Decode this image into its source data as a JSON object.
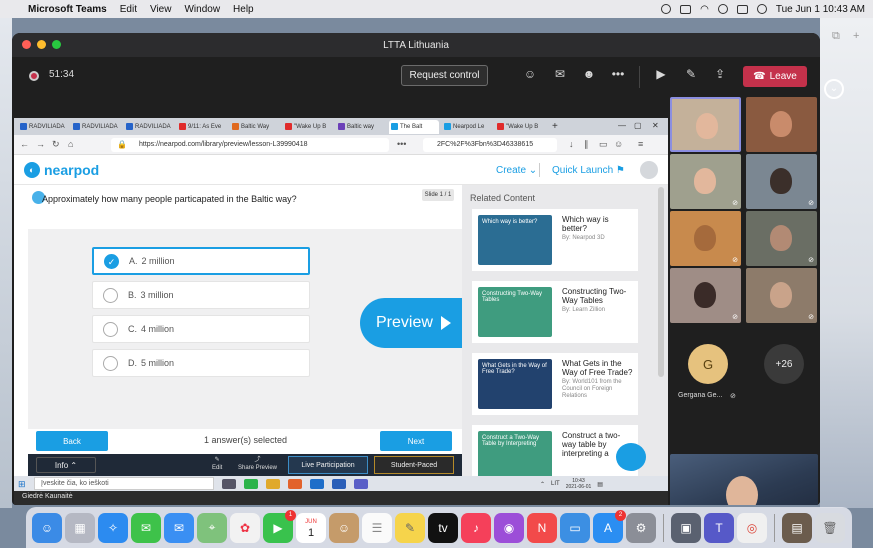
{
  "menubar": {
    "app": "Microsoft Teams",
    "items": [
      "Edit",
      "View",
      "Window",
      "Help"
    ],
    "clock": "Tue Jun 1  10:43 AM"
  },
  "teams": {
    "window_title": "LTTA Lithuania",
    "timer": "51:34",
    "request_control": "Request control",
    "leave": "Leave"
  },
  "browser": {
    "tabs": [
      {
        "label": "RADVILIADA",
        "color": "#2563c9"
      },
      {
        "label": "RADVILIADA",
        "color": "#2563c9"
      },
      {
        "label": "RADVILIADA",
        "color": "#2563c9"
      },
      {
        "label": "9/11: As Eve",
        "color": "#e02b2b"
      },
      {
        "label": "Baltic Way",
        "color": "#e06a1f"
      },
      {
        "label": "\"Wake Up B",
        "color": "#e02b2b"
      },
      {
        "label": "Baltic way",
        "color": "#6b3fb8"
      },
      {
        "label": "The Balt",
        "color": "#1a9ee3"
      },
      {
        "label": "Nearpod Le",
        "color": "#1a9ee3"
      },
      {
        "label": "\"Wake Up B",
        "color": "#e02b2b"
      }
    ],
    "url": "https://nearpod.com/library/preview/lesson-L39990418",
    "search": "2FC%2F%3Fbn%3D46338615"
  },
  "nearpod": {
    "logo": "nearpod",
    "create": "Create",
    "quick_launch": "Quick Launch",
    "question": "Approximately how many people particapated in the Baltic way?",
    "slide": "Slide 1 / 1",
    "options": [
      {
        "letter": "A.",
        "text": "2 million",
        "selected": true
      },
      {
        "letter": "B.",
        "text": "3 million",
        "selected": false
      },
      {
        "letter": "C.",
        "text": "4 million",
        "selected": false
      },
      {
        "letter": "D.",
        "text": "5 million",
        "selected": false
      }
    ],
    "preview": "Preview",
    "back": "Back",
    "next": "Next",
    "answered": "1 answer(s) selected",
    "info": "Info",
    "edit": "Edit",
    "share_preview": "Share Preview",
    "live": "Live Participation",
    "student_paced": "Student-Paced",
    "related_title": "Related Content",
    "related": [
      {
        "title": "Which way is better?",
        "by": "By: Nearpod 3D",
        "thumb": "Which way is better?",
        "color": "#2b6d93"
      },
      {
        "title": "Constructing Two-Way Tables",
        "by": "By: Learn Zillion",
        "thumb": "Constructing Two-Way Tables",
        "color": "#3f9c7f"
      },
      {
        "title": "What Gets in the Way of Free Trade?",
        "by": "By: World101 from the Council on Foreign Relations",
        "thumb": "What Gets in the Way of Free Trade?",
        "color": "#22426e"
      },
      {
        "title": "Construct a two-way table by interpreting a",
        "by": "",
        "thumb": "Construct a Two-Way Table by Interpreting",
        "color": "#3f9c7f"
      }
    ]
  },
  "windows": {
    "search": "Įveskite čia, ko ieškoti",
    "lang": "LIT",
    "time": "10:43",
    "date": "2021-06-01"
  },
  "presenter": "Giedrė Kaunaitė",
  "participants": {
    "initial": "G",
    "extra": "+26",
    "name": "Gergana Ge..."
  },
  "dock": {
    "badges": {
      "facetime": "1",
      "appstore": "2"
    },
    "calendar_month": "JUN",
    "calendar_day": "1"
  }
}
